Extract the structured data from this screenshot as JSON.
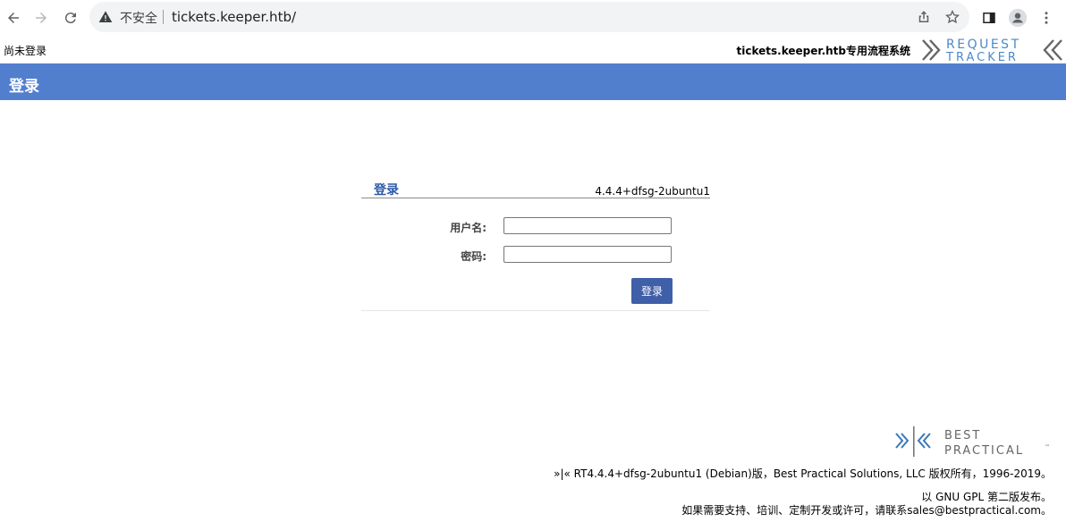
{
  "browser": {
    "security_label": "不安全",
    "url": "tickets.keeper.htb/"
  },
  "topbar": {
    "login_status": "尚未登录",
    "system_name": "tickets.keeper.htb专用流程系统",
    "logo_line1": "REQUEST",
    "logo_line2": "TRACKER"
  },
  "page": {
    "title": "登录"
  },
  "login": {
    "heading": "登录",
    "version": "4.4.4+dfsg-2ubuntu1",
    "username_label": "用户名:",
    "username_value": "",
    "password_label": "密码:",
    "password_value": "",
    "submit_label": "登录"
  },
  "footer": {
    "logo_line1": "BEST",
    "logo_line2": "PRACTICAL",
    "logo_tm": "™",
    "copyright": "»|« RT4.4.4+dfsg-2ubuntu1 (Debian)版，Best Practical Solutions, LLC 版权所有，1996-2019。",
    "license": "以 GNU GPL 第二版发布。",
    "contact": "如果需要支持、培训、定制开发或许可，请联系sales@bestpractical.com。"
  },
  "colors": {
    "title_bar": "#527ece",
    "heading": "#2b59a8",
    "button": "#3f5fa8"
  }
}
